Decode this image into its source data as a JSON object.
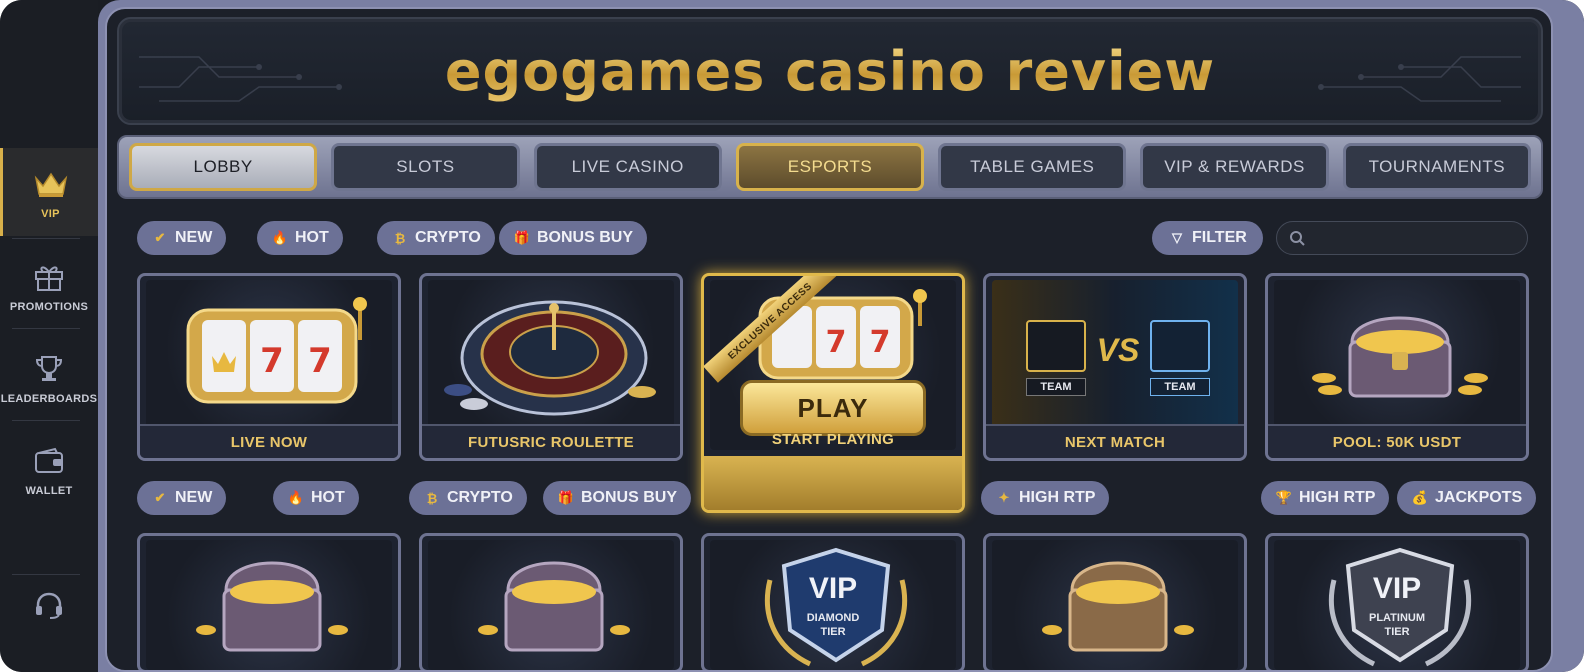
{
  "sidebar": {
    "items": [
      {
        "label": "VIP",
        "icon": "crown-icon"
      },
      {
        "label": "PROMOTIONS",
        "icon": "gift-icon"
      },
      {
        "label": "LEADERBOARDS",
        "icon": "trophy-icon"
      },
      {
        "label": "WALLET",
        "icon": "wallet-icon"
      }
    ],
    "support_icon": "headset-icon"
  },
  "banner": {
    "title": "egogames casino review"
  },
  "tabs": [
    {
      "label": "LOBBY",
      "state": "selected"
    },
    {
      "label": "SLOTS"
    },
    {
      "label": "LIVE CASINO"
    },
    {
      "label": "ESPORTS",
      "state": "highlight"
    },
    {
      "label": "TABLE GAMES"
    },
    {
      "label": "VIP & REWARDS"
    },
    {
      "label": "TOURNAMENTS"
    }
  ],
  "filters_top": [
    {
      "label": "NEW",
      "icon": "check-badge-icon"
    },
    {
      "label": "HOT",
      "icon": "flame-icon"
    },
    {
      "label": "CRYPTO",
      "icon": "bitcoin-icon"
    },
    {
      "label": "BONUS BUY",
      "icon": "gift-icon"
    }
  ],
  "filter_button": {
    "label": "FILTER",
    "icon": "funnel-icon"
  },
  "search": {
    "placeholder": ""
  },
  "cards_row1": [
    {
      "label": "LIVE NOW",
      "art": "slot-machine"
    },
    {
      "label": "FUTUSRIC ROULETTE",
      "art": "roulette-wheel"
    },
    {
      "label": "START PLAYING",
      "art": "slot-machine",
      "button": "PLAY",
      "ribbon": "EXCLUSIVE ACCESS"
    },
    {
      "label": "NEXT MATCH",
      "art": "team-vs-team",
      "vs": "VS",
      "team_a": "TEAM",
      "team_b": "TEAM"
    },
    {
      "label": "POOL: 50K USDT",
      "art": "treasure-chest"
    }
  ],
  "filters_bottom_left": [
    {
      "label": "NEW",
      "icon": "check-badge-icon"
    },
    {
      "label": "HOT",
      "icon": "flame-icon"
    },
    {
      "label": "CRYPTO",
      "icon": "bitcoin-icon"
    },
    {
      "label": "BONUS BUY",
      "icon": "gift-icon"
    }
  ],
  "filter_high_rtp_mid": {
    "label": "HIGH RTP",
    "icon": "ticket-icon"
  },
  "filters_bottom_right": [
    {
      "label": "HIGH RTP",
      "icon": "trophy-icon"
    },
    {
      "label": "JACKPOTS",
      "icon": "money-bag-icon"
    }
  ],
  "cards_row2": [
    {
      "art": "treasure-chest"
    },
    {
      "art": "treasure-chest"
    },
    {
      "art": "vip-badge",
      "badge": "VIP",
      "tier_line1": "DIAMOND",
      "tier_line2": "TIER"
    },
    {
      "art": "treasure-chest"
    },
    {
      "art": "vip-badge",
      "badge": "VIP",
      "tier_line1": "PLATINUM",
      "tier_line2": "TIER"
    }
  ],
  "colors": {
    "gold": "#e0b94b",
    "chip": "#6c7196",
    "panel": "#1c2029",
    "frame": "#7a7fa3"
  }
}
